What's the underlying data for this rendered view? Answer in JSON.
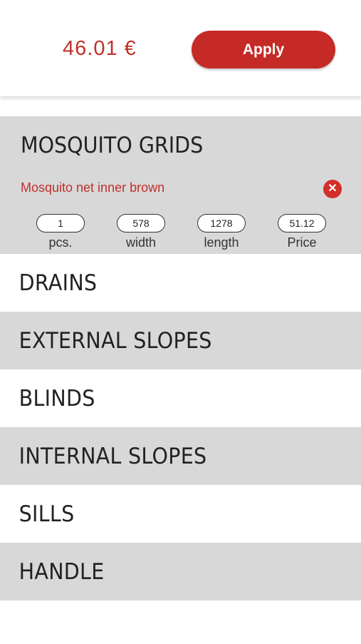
{
  "header": {
    "total": "46.01 €",
    "apply_label": "Apply"
  },
  "colors": {
    "accent": "#c62a26",
    "section_bg": "#d8d8d8",
    "battery": "#6cc46c"
  },
  "categories": {
    "mosquito": {
      "label": "MOSQUITO GRIDS",
      "item": {
        "name": "Mosquito net inner brown",
        "remove_icon": "close-circle-icon",
        "fields": [
          {
            "value": "1",
            "caption": "pcs."
          },
          {
            "value": "578",
            "caption": "width"
          },
          {
            "value": "1278",
            "caption": "length"
          },
          {
            "value": "51.12",
            "caption": "Price"
          }
        ]
      }
    },
    "others": [
      {
        "label": "DRAINS"
      },
      {
        "label": "EXTERNAL SLOPES"
      },
      {
        "label": "BLINDS"
      },
      {
        "label": "INTERNAL SLOPES"
      },
      {
        "label": "SILLS"
      },
      {
        "label": "HANDLE"
      }
    ]
  }
}
